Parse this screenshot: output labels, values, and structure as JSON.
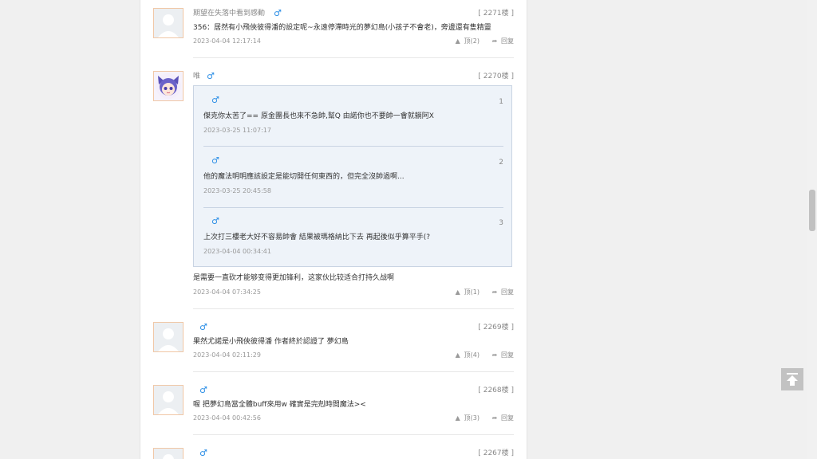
{
  "posts": [
    {
      "user": "期望在失落中看到感動",
      "floor": "[ 2271楼 ]",
      "text": "356：居然有小飛俠彼得潘的設定呢~永遠停滯時光的夢幻島(小孩子不會老)，旁邊還有隻精靈",
      "time": "2023-04-04 12:17:14",
      "likes": "顶(2)",
      "reply": "回复"
    },
    {
      "user": "唯",
      "floor": "[ 2270楼 ]",
      "text": "是需要一直砍才能够变得更加锋利，这家伙比较适合打持久战啊",
      "time": "2023-04-04 07:34:25",
      "likes": "顶(1)",
      "reply": "回复",
      "quotes": [
        {
          "num": "1",
          "text": "傑克你太苦了== 原金團長也來不急帥,幫Q 由諾你也不要帥一會就躺阿X",
          "time": "2023-03-25 11:07:17"
        },
        {
          "num": "2",
          "text": "他的魔法明明應該設定是能切開任何東西的，但完全沒帥過啊...",
          "time": "2023-03-25 20:45:58"
        },
        {
          "num": "3",
          "text": "上次打三樓老大好不容易帥會 結果被瑪格納比下去 再起後似乎算平手(?",
          "time": "2023-04-04 00:34:41"
        }
      ]
    },
    {
      "user": "",
      "floor": "[ 2269楼 ]",
      "text": "果然尤諾是小飛俠彼得潘 作者終於認證了 夢幻島",
      "time": "2023-04-04 02:11:29",
      "likes": "顶(4)",
      "reply": "回复"
    },
    {
      "user": "",
      "floor": "[ 2268楼 ]",
      "text": "喔 把夢幻島當全體buff來用w 確實是完剋時間魔法><",
      "time": "2023-04-04 00:42:56",
      "likes": "顶(3)",
      "reply": "回复"
    },
    {
      "user": "",
      "floor": "[ 2267楼 ]"
    }
  ],
  "icons": {
    "gender": "male-symbol-icon",
    "like": "thumbs-up-icon",
    "reply": "reply-arrow-icon",
    "top": "back-to-top-icon"
  },
  "colors": {
    "gender": "#2d8fe6",
    "quote_bg": "#eef3f9",
    "avatar_border": "#f0c7a6"
  }
}
